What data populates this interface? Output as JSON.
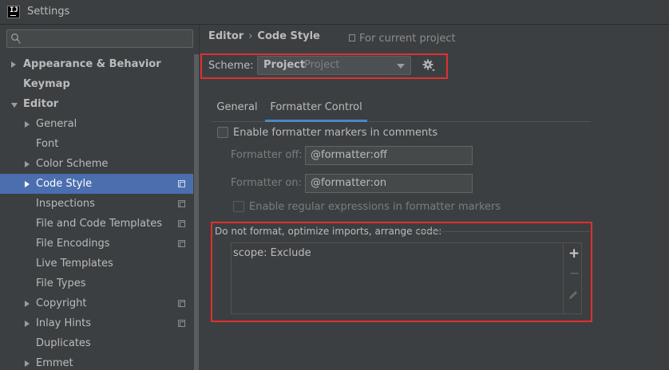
{
  "window": {
    "title": "Settings",
    "app_icon_text": "IJ"
  },
  "search": {
    "placeholder": ""
  },
  "sidebar": {
    "items": [
      {
        "label": "Appearance & Behavior",
        "level": 0,
        "bold": true,
        "arrow": "right",
        "copy_icon": false,
        "selected": false
      },
      {
        "label": "Keymap",
        "level": 0,
        "bold": true,
        "arrow": "none",
        "copy_icon": false,
        "selected": false
      },
      {
        "label": "Editor",
        "level": 0,
        "bold": true,
        "arrow": "down",
        "copy_icon": false,
        "selected": false
      },
      {
        "label": "General",
        "level": 1,
        "bold": false,
        "arrow": "right",
        "copy_icon": false,
        "selected": false
      },
      {
        "label": "Font",
        "level": 1,
        "bold": false,
        "arrow": "none",
        "copy_icon": false,
        "selected": false
      },
      {
        "label": "Color Scheme",
        "level": 1,
        "bold": false,
        "arrow": "right",
        "copy_icon": false,
        "selected": false
      },
      {
        "label": "Code Style",
        "level": 1,
        "bold": false,
        "arrow": "right",
        "copy_icon": true,
        "selected": true
      },
      {
        "label": "Inspections",
        "level": 1,
        "bold": false,
        "arrow": "none",
        "copy_icon": true,
        "selected": false
      },
      {
        "label": "File and Code Templates",
        "level": 1,
        "bold": false,
        "arrow": "none",
        "copy_icon": true,
        "selected": false
      },
      {
        "label": "File Encodings",
        "level": 1,
        "bold": false,
        "arrow": "none",
        "copy_icon": true,
        "selected": false
      },
      {
        "label": "Live Templates",
        "level": 1,
        "bold": false,
        "arrow": "none",
        "copy_icon": false,
        "selected": false
      },
      {
        "label": "File Types",
        "level": 1,
        "bold": false,
        "arrow": "none",
        "copy_icon": false,
        "selected": false
      },
      {
        "label": "Copyright",
        "level": 1,
        "bold": false,
        "arrow": "right",
        "copy_icon": true,
        "selected": false
      },
      {
        "label": "Inlay Hints",
        "level": 1,
        "bold": false,
        "arrow": "right",
        "copy_icon": true,
        "selected": false
      },
      {
        "label": "Duplicates",
        "level": 1,
        "bold": false,
        "arrow": "none",
        "copy_icon": false,
        "selected": false
      },
      {
        "label": "Emmet",
        "level": 1,
        "bold": false,
        "arrow": "right",
        "copy_icon": false,
        "selected": false
      }
    ]
  },
  "breadcrumb": {
    "parent": "Editor",
    "separator": "›",
    "current": "Code Style",
    "scope_note": "For current project"
  },
  "scheme": {
    "label": "Scheme:",
    "name": "Project",
    "type": "Project"
  },
  "tabs": [
    {
      "label": "General",
      "active": false
    },
    {
      "label": "Formatter Control",
      "active": true
    }
  ],
  "formatter": {
    "enable_markers_label": "Enable formatter markers in comments",
    "enable_markers_checked": false,
    "off_label": "Formatter off:",
    "off_value": "@formatter:off",
    "on_label": "Formatter on:",
    "on_value": "@formatter:on",
    "regex_label": "Enable regular expressions in formatter markers",
    "regex_checked": false
  },
  "exclusions": {
    "title": "Do not format, optimize imports, arrange code:",
    "entries": [
      "scope: Exclude"
    ],
    "add_glyph": "+",
    "remove_glyph": "−"
  },
  "colors": {
    "background": "#3c3f41",
    "selection": "#4b6eaf",
    "tab_underline": "#4a88c7",
    "highlight_box": "#e0302f"
  }
}
